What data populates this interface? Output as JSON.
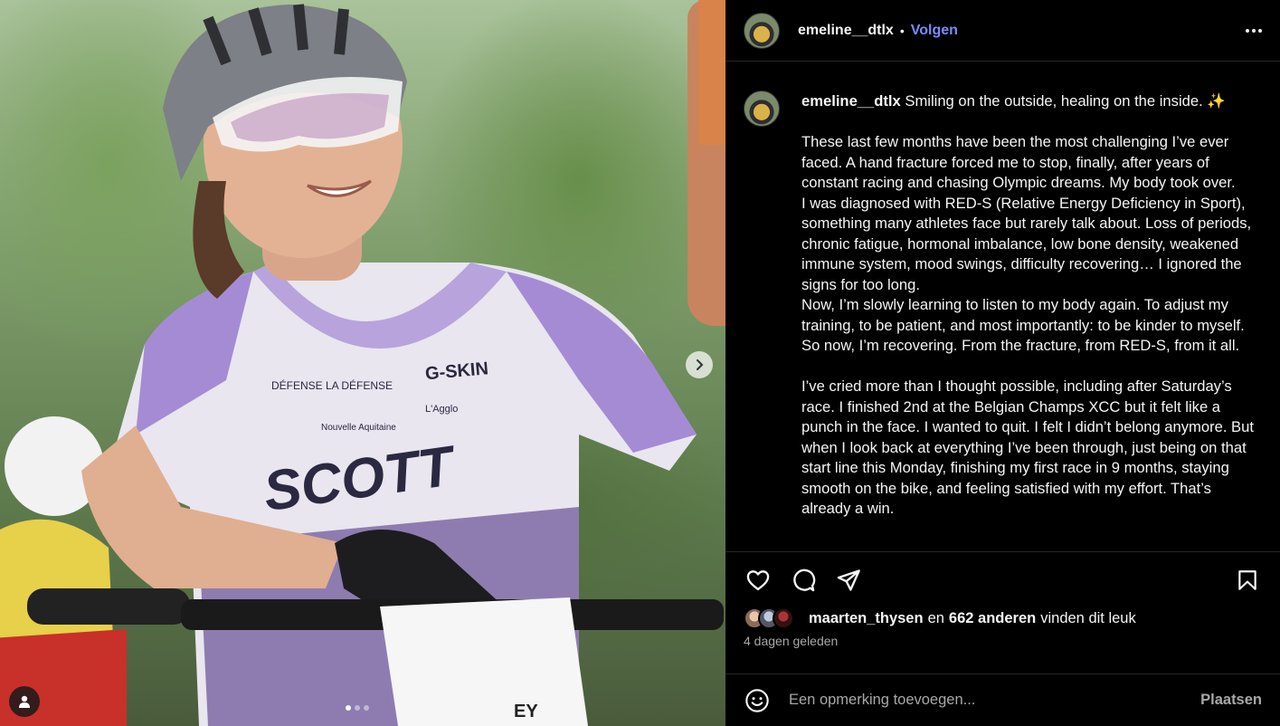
{
  "post": {
    "username": "emeline__dtlx",
    "follow_label": "Volgen",
    "separator": "•",
    "caption_username": "emeline__dtlx",
    "caption_text": " Smiling on the outside, healing on the inside. ✨\n\nThese last few months have been the most challenging I’ve ever faced. A hand fracture forced me to stop, finally, after years of constant racing and chasing Olympic dreams. My body took over.\nI was diagnosed with RED-S (Relative Energy Deficiency in Sport), something many athletes face but rarely talk about. Loss of periods, chronic fatigue, hormonal imbalance, low bone density, weakened immune system, mood swings, difficulty recovering… I ignored the signs for too long.\nNow, I’m slowly learning to listen to my body again. To adjust my training, to be patient, and most importantly: to be kinder to myself.\nSo now, I’m recovering. From the fracture, from RED-S, from it all.\n\nI’ve cried more than I thought possible, including after Saturday’s race. I finished 2nd at the Belgian Champs XCC but it felt like a punch in the face. I wanted to quit. I felt I didn’t belong anymore. But when I look back at everything I’ve been through, just being on that start line this Monday, finishing my first race in 9 months, staying smooth on the bike, and feeling satisfied with my effort. That’s already a win."
  },
  "photo": {
    "jersey_brand": "SCOTT",
    "jersey_sponsor": "G-SKIN",
    "jersey_defense": "DÉFENSE LA DÉFENSE",
    "jersey_region": "Nouvelle Aquitaine",
    "jersey_agglo": "L'Agglo",
    "number_plate_sponsors": "EY",
    "carousel": {
      "total": 3,
      "active": 0
    }
  },
  "likes": {
    "first_liker": "maarten_thysen",
    "joiner": "en",
    "others": "662 anderen",
    "suffix": "vinden dit leuk"
  },
  "timestamp": "4 dagen geleden",
  "comment": {
    "placeholder": "Een opmerking toevoegen...",
    "post_label": "Plaatsen"
  },
  "icons": {
    "more": "more-horizontal-icon",
    "like": "heart-icon",
    "comment": "comment-icon",
    "share": "send-icon",
    "save": "bookmark-icon",
    "emoji": "emoji-icon",
    "next": "chevron-right-icon",
    "tag": "user-tag-icon"
  },
  "colors": {
    "follow_link": "#7b8cff",
    "panel_bg": "#000000",
    "muted_text": "#a8a8a8"
  }
}
